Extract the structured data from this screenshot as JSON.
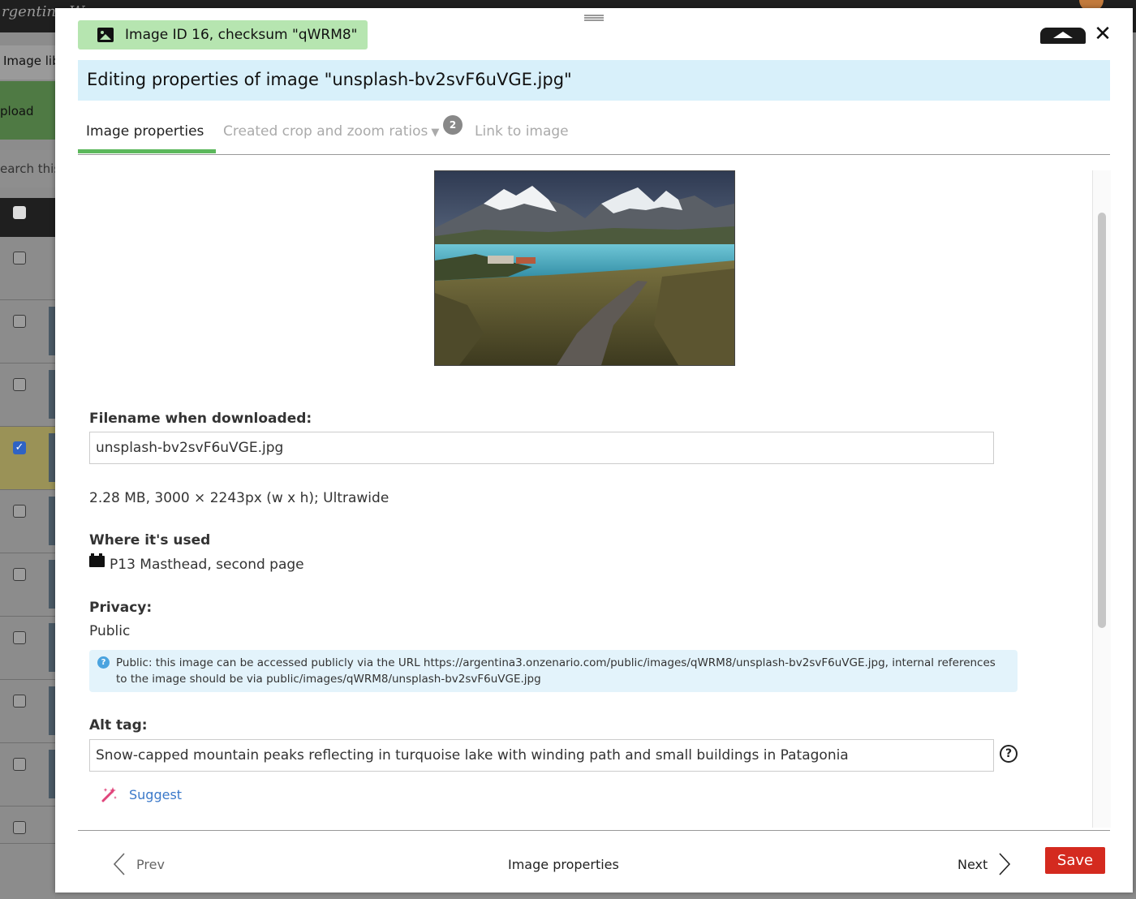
{
  "background": {
    "brand": "rgentina W",
    "library_label": "Image lib",
    "upload_label": "pload",
    "search_label": "earch this"
  },
  "modal": {
    "badge": "Image ID 16, checksum \"qWRM8\"",
    "title": "Editing properties of image \"unsplash-bv2svF6uVGE.jpg\"",
    "tabs": [
      {
        "label": "Image properties"
      },
      {
        "label": "Created crop and zoom ratios",
        "count": "2"
      },
      {
        "label": "Link to image"
      }
    ],
    "preview_image": "mountain-lake-landscape",
    "filename_label": "Filename when downloaded:",
    "filename_value": "unsplash-bv2svF6uVGE.jpg",
    "file_info": "2.28 MB, 3000 × 2243px (w x h); Ultrawide",
    "usage_label": "Where it's used",
    "usage_item": "P13 Masthead, second page",
    "privacy_label": "Privacy:",
    "privacy_value": "Public",
    "privacy_info": "Public: this image can be accessed publicly via the URL https://argentina3.onzenario.com/public/images/qWRM8/unsplash-bv2svF6uVGE.jpg, internal references to the image should be via public/images/qWRM8/unsplash-bv2svF6uVGE.jpg",
    "alt_label": "Alt tag:",
    "alt_value": "Snow-capped mountain peaks reflecting in turquoise lake with winding path and small buildings in Patagonia",
    "suggest_label": "Suggest",
    "footer": {
      "prev": "Prev",
      "title": "Image properties",
      "next": "Next",
      "save": "Save"
    }
  },
  "colors": {
    "badge_bg": "#b6e5b0",
    "title_bg": "#d8f0fa",
    "tab_accent": "#5cb85c",
    "save_bg": "#d42a1f",
    "info_bg": "#e3f3fb",
    "link": "#3a78c9"
  }
}
